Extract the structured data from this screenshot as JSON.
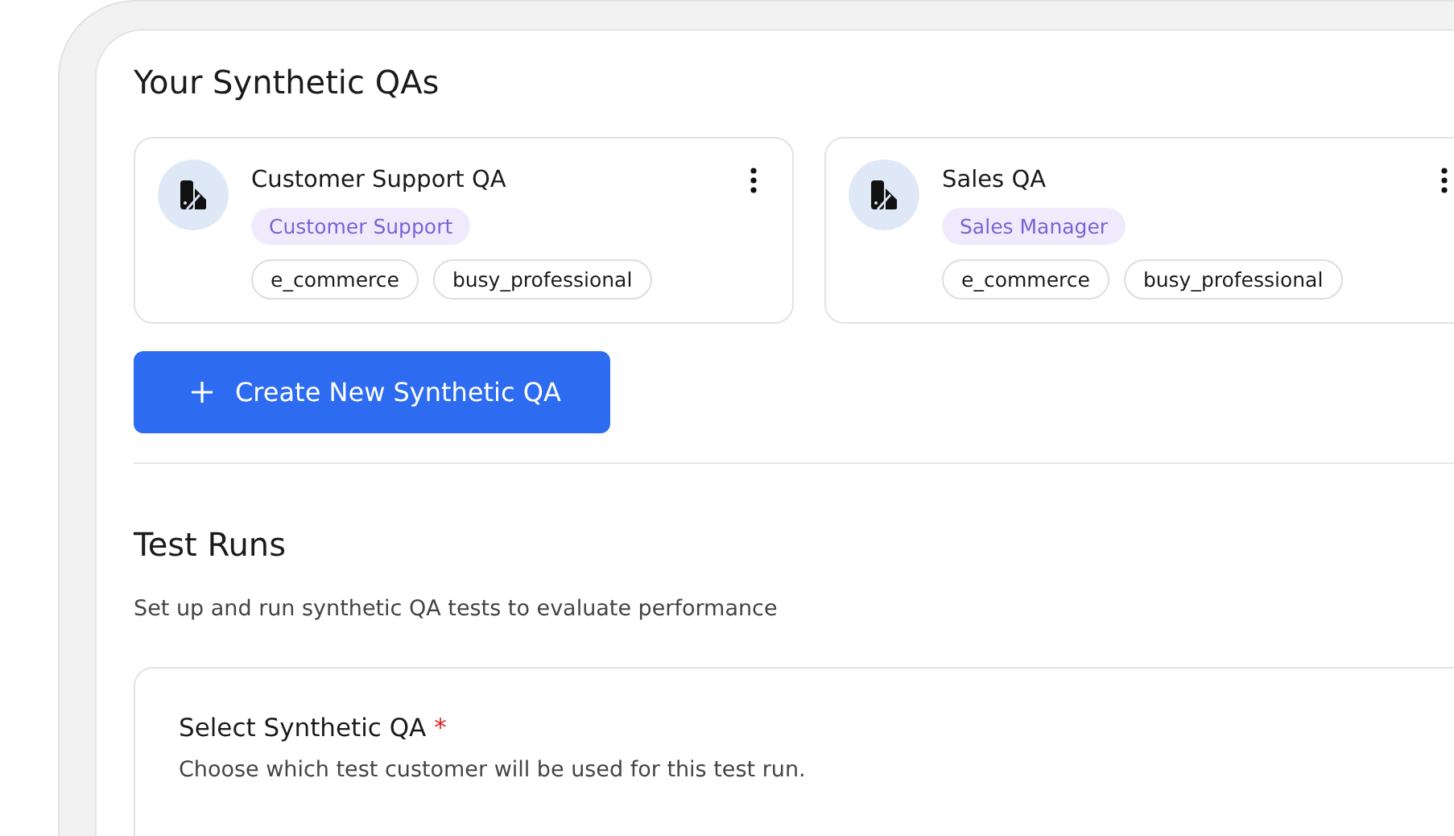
{
  "synthetic_qas": {
    "title": "Your Synthetic QAs",
    "cards": [
      {
        "name": "Customer Support QA",
        "role": "Customer Support",
        "tags": [
          "e_commerce",
          "busy_professional"
        ]
      },
      {
        "name": "Sales QA",
        "role": "Sales Manager",
        "tags": [
          "e_commerce",
          "busy_professional"
        ]
      }
    ],
    "create_button": "Create New Synthetic QA"
  },
  "test_runs": {
    "title": "Test Runs",
    "description": "Set up and run synthetic QA tests to evaluate performance",
    "select": {
      "label": "Select Synthetic QA",
      "required_mark": "*",
      "help": "Choose which test customer will be used for this test run."
    }
  }
}
